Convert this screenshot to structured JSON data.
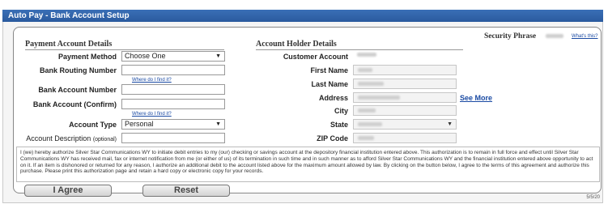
{
  "header": {
    "title": "Auto Pay - Bank Account Setup"
  },
  "security": {
    "label": "Security Phrase",
    "link": "What's this?"
  },
  "payment": {
    "section_title": "Payment Account Details",
    "method_label": "Payment Method",
    "method_value": "Choose One",
    "routing_label": "Bank Routing Number",
    "routing_value": "",
    "find_link_1": "Where do I find it?",
    "account_number_label": "Bank Account Number",
    "account_number_value": "",
    "account_confirm_label": "Bank Account (Confirm)",
    "account_confirm_value": "",
    "find_link_2": "Where do I find it?",
    "account_type_label": "Account Type",
    "account_type_value": "Personal",
    "description_label": "Account Description",
    "description_optional": "(optional)",
    "description_value": ""
  },
  "holder": {
    "section_title": "Account Holder Details",
    "customer_label": "Customer Account",
    "first_name_label": "First Name",
    "last_name_label": "Last Name",
    "address_label": "Address",
    "see_more": "See More",
    "city_label": "City",
    "state_label": "State",
    "zip_label": "ZIP Code"
  },
  "authorization": {
    "text": "I (we) hereby authorize Silver Star Communications WY to initiate debit entries to my (our) checking or savings account at the depository financial institution entered above. This authorization is to remain in full force and effect until Silver Star Communications WY has received mail, fax or internet notification from me (or either of us) of its termination in such time and in such manner as to afford Silver Star Communications WY and the financial institution entered above opportunity to act on it. If an item is dishonored or returned for any reason, I authorize an additional debit to the account listed above for the maximum amount allowed by law. By clicking on the button below, I agree to the terms of this agreement and authorize this purchase. Please print this authorization page and retain a hard copy or electronic copy for your records."
  },
  "buttons": {
    "agree": "I Agree",
    "reset": "Reset"
  },
  "footer": {
    "page": "5/5/20"
  },
  "icons": {
    "dropdown": "chevron-down-icon"
  },
  "colors": {
    "title_bar": "#2a5a9e",
    "link": "#1a4aa3"
  }
}
